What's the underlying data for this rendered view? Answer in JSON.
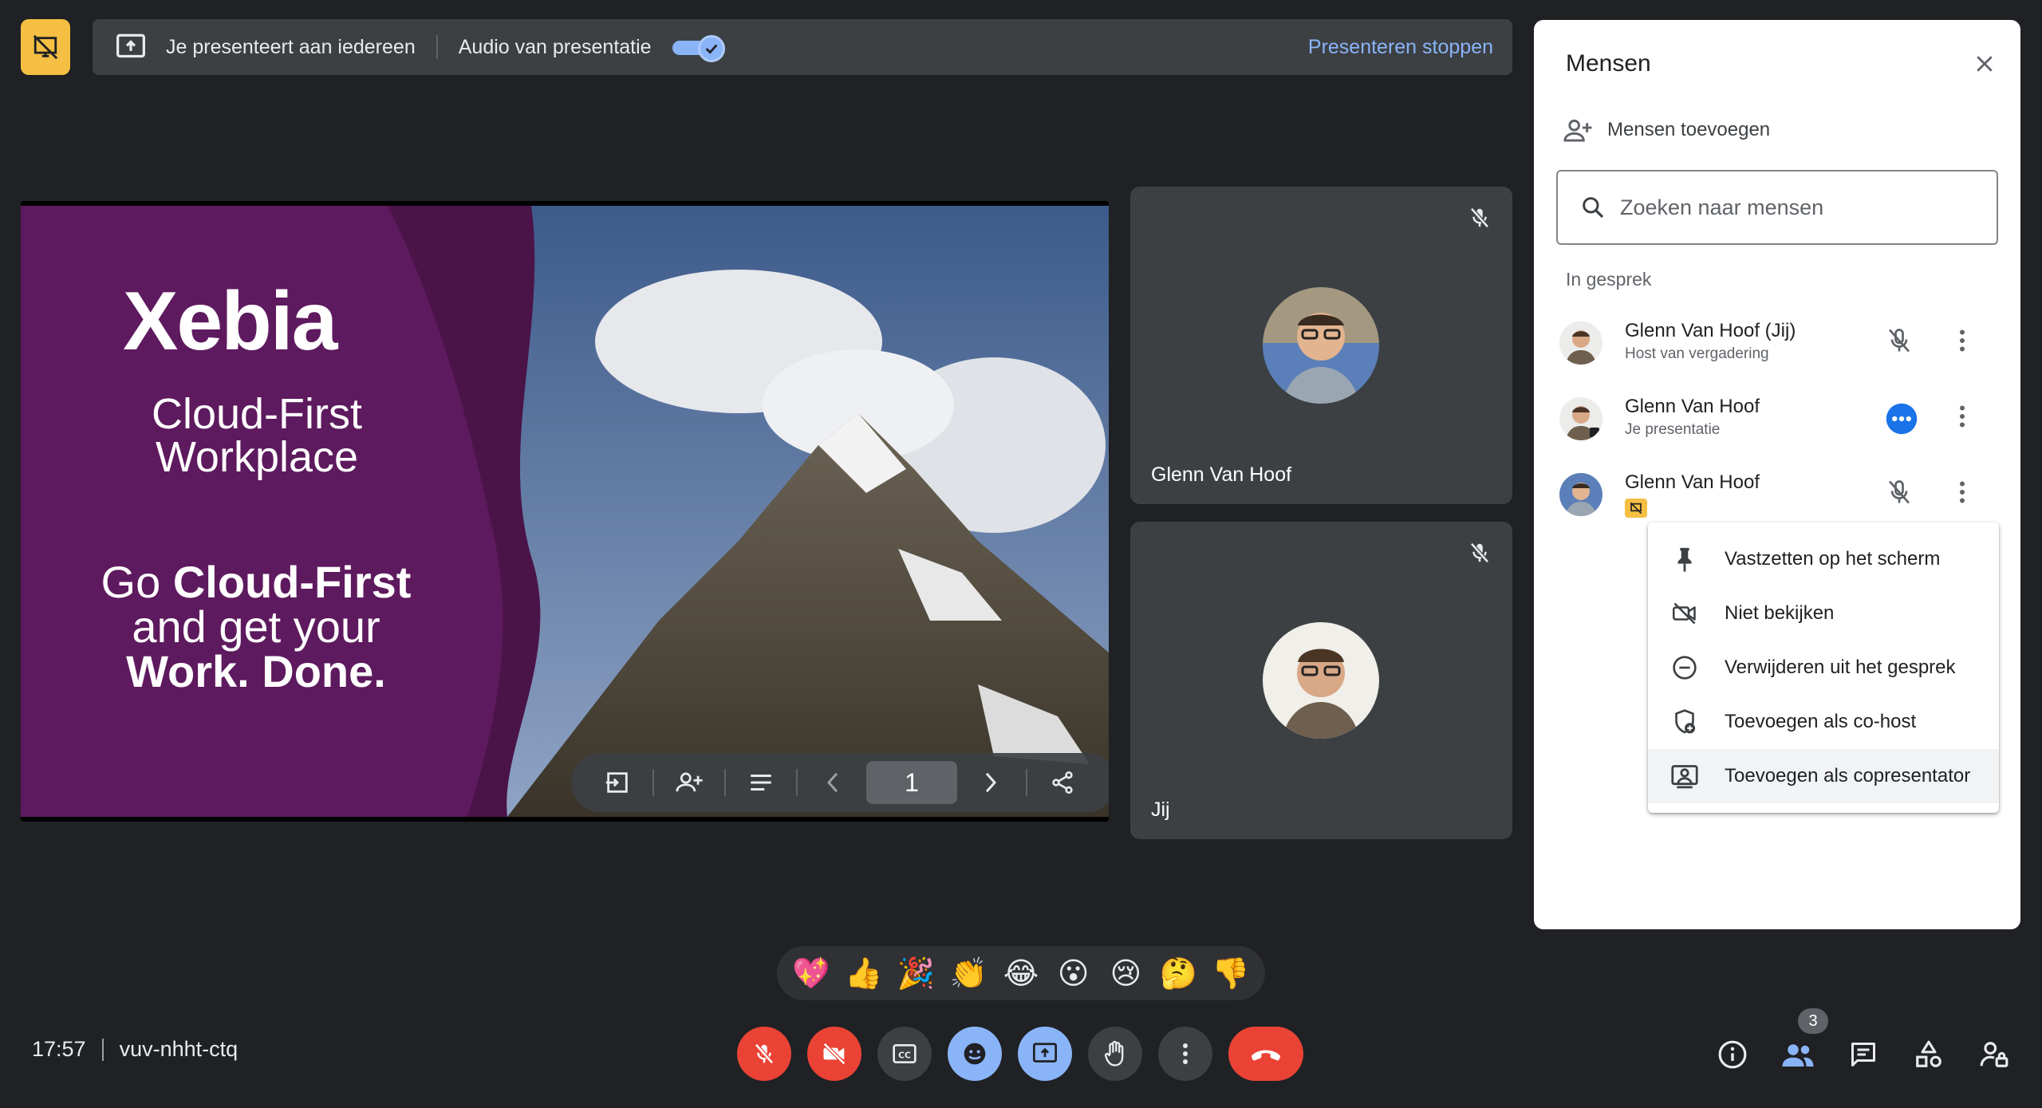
{
  "top_bar": {
    "presenting_text": "Je presenteert aan iedereen",
    "audio_label": "Audio van presentatie",
    "audio_enabled": true,
    "stop_label": "Presenteren stoppen"
  },
  "slide": {
    "brand": "Xebia",
    "headline": "Cloud-First Workplace",
    "tagline_1_normal": "Go ",
    "tagline_1_bold": "Cloud-First",
    "tagline_2": "and get your",
    "tagline_3": "Work. Done.",
    "page_number": "1"
  },
  "tiles": [
    {
      "name": "Glenn Van Hoof",
      "muted": true
    },
    {
      "name": "Jij",
      "muted": true
    }
  ],
  "reactions": [
    "💖",
    "👍",
    "🎉",
    "👏",
    "😂",
    "😮",
    "😢",
    "🤔",
    "👎"
  ],
  "meeting": {
    "time": "17:57",
    "code": "vuv-nhht-ctq"
  },
  "people_panel": {
    "title": "Mensen",
    "add_label": "Mensen toevoegen",
    "search_placeholder": "Zoeken naar mensen",
    "section_label": "In gesprek",
    "people_count": "3",
    "participants": [
      {
        "name": "Glenn Van Hoof (Jij)",
        "subtitle": "Host van vergadering"
      },
      {
        "name": "Glenn Van Hoof",
        "subtitle": "Je presentatie"
      },
      {
        "name": "Glenn Van Hoof",
        "subtitle": ""
      }
    ]
  },
  "context_menu": [
    {
      "label": "Vastzetten op het scherm",
      "icon": "pin-icon"
    },
    {
      "label": "Niet bekijken",
      "icon": "video-off-icon"
    },
    {
      "label": "Verwijderen uit het gesprek",
      "icon": "remove-circle-icon"
    },
    {
      "label": "Toevoegen als co-host",
      "icon": "shield-add-icon"
    },
    {
      "label": "Toevoegen als copresentator",
      "icon": "copresenter-icon"
    }
  ],
  "colors": {
    "background": "#202124",
    "surface": "#3c4043",
    "accent_blue": "#8ab4f8",
    "danger_red": "#ea4335",
    "presenting_yellow": "#f4bf42",
    "slide_purple": "#5e1a5e"
  }
}
